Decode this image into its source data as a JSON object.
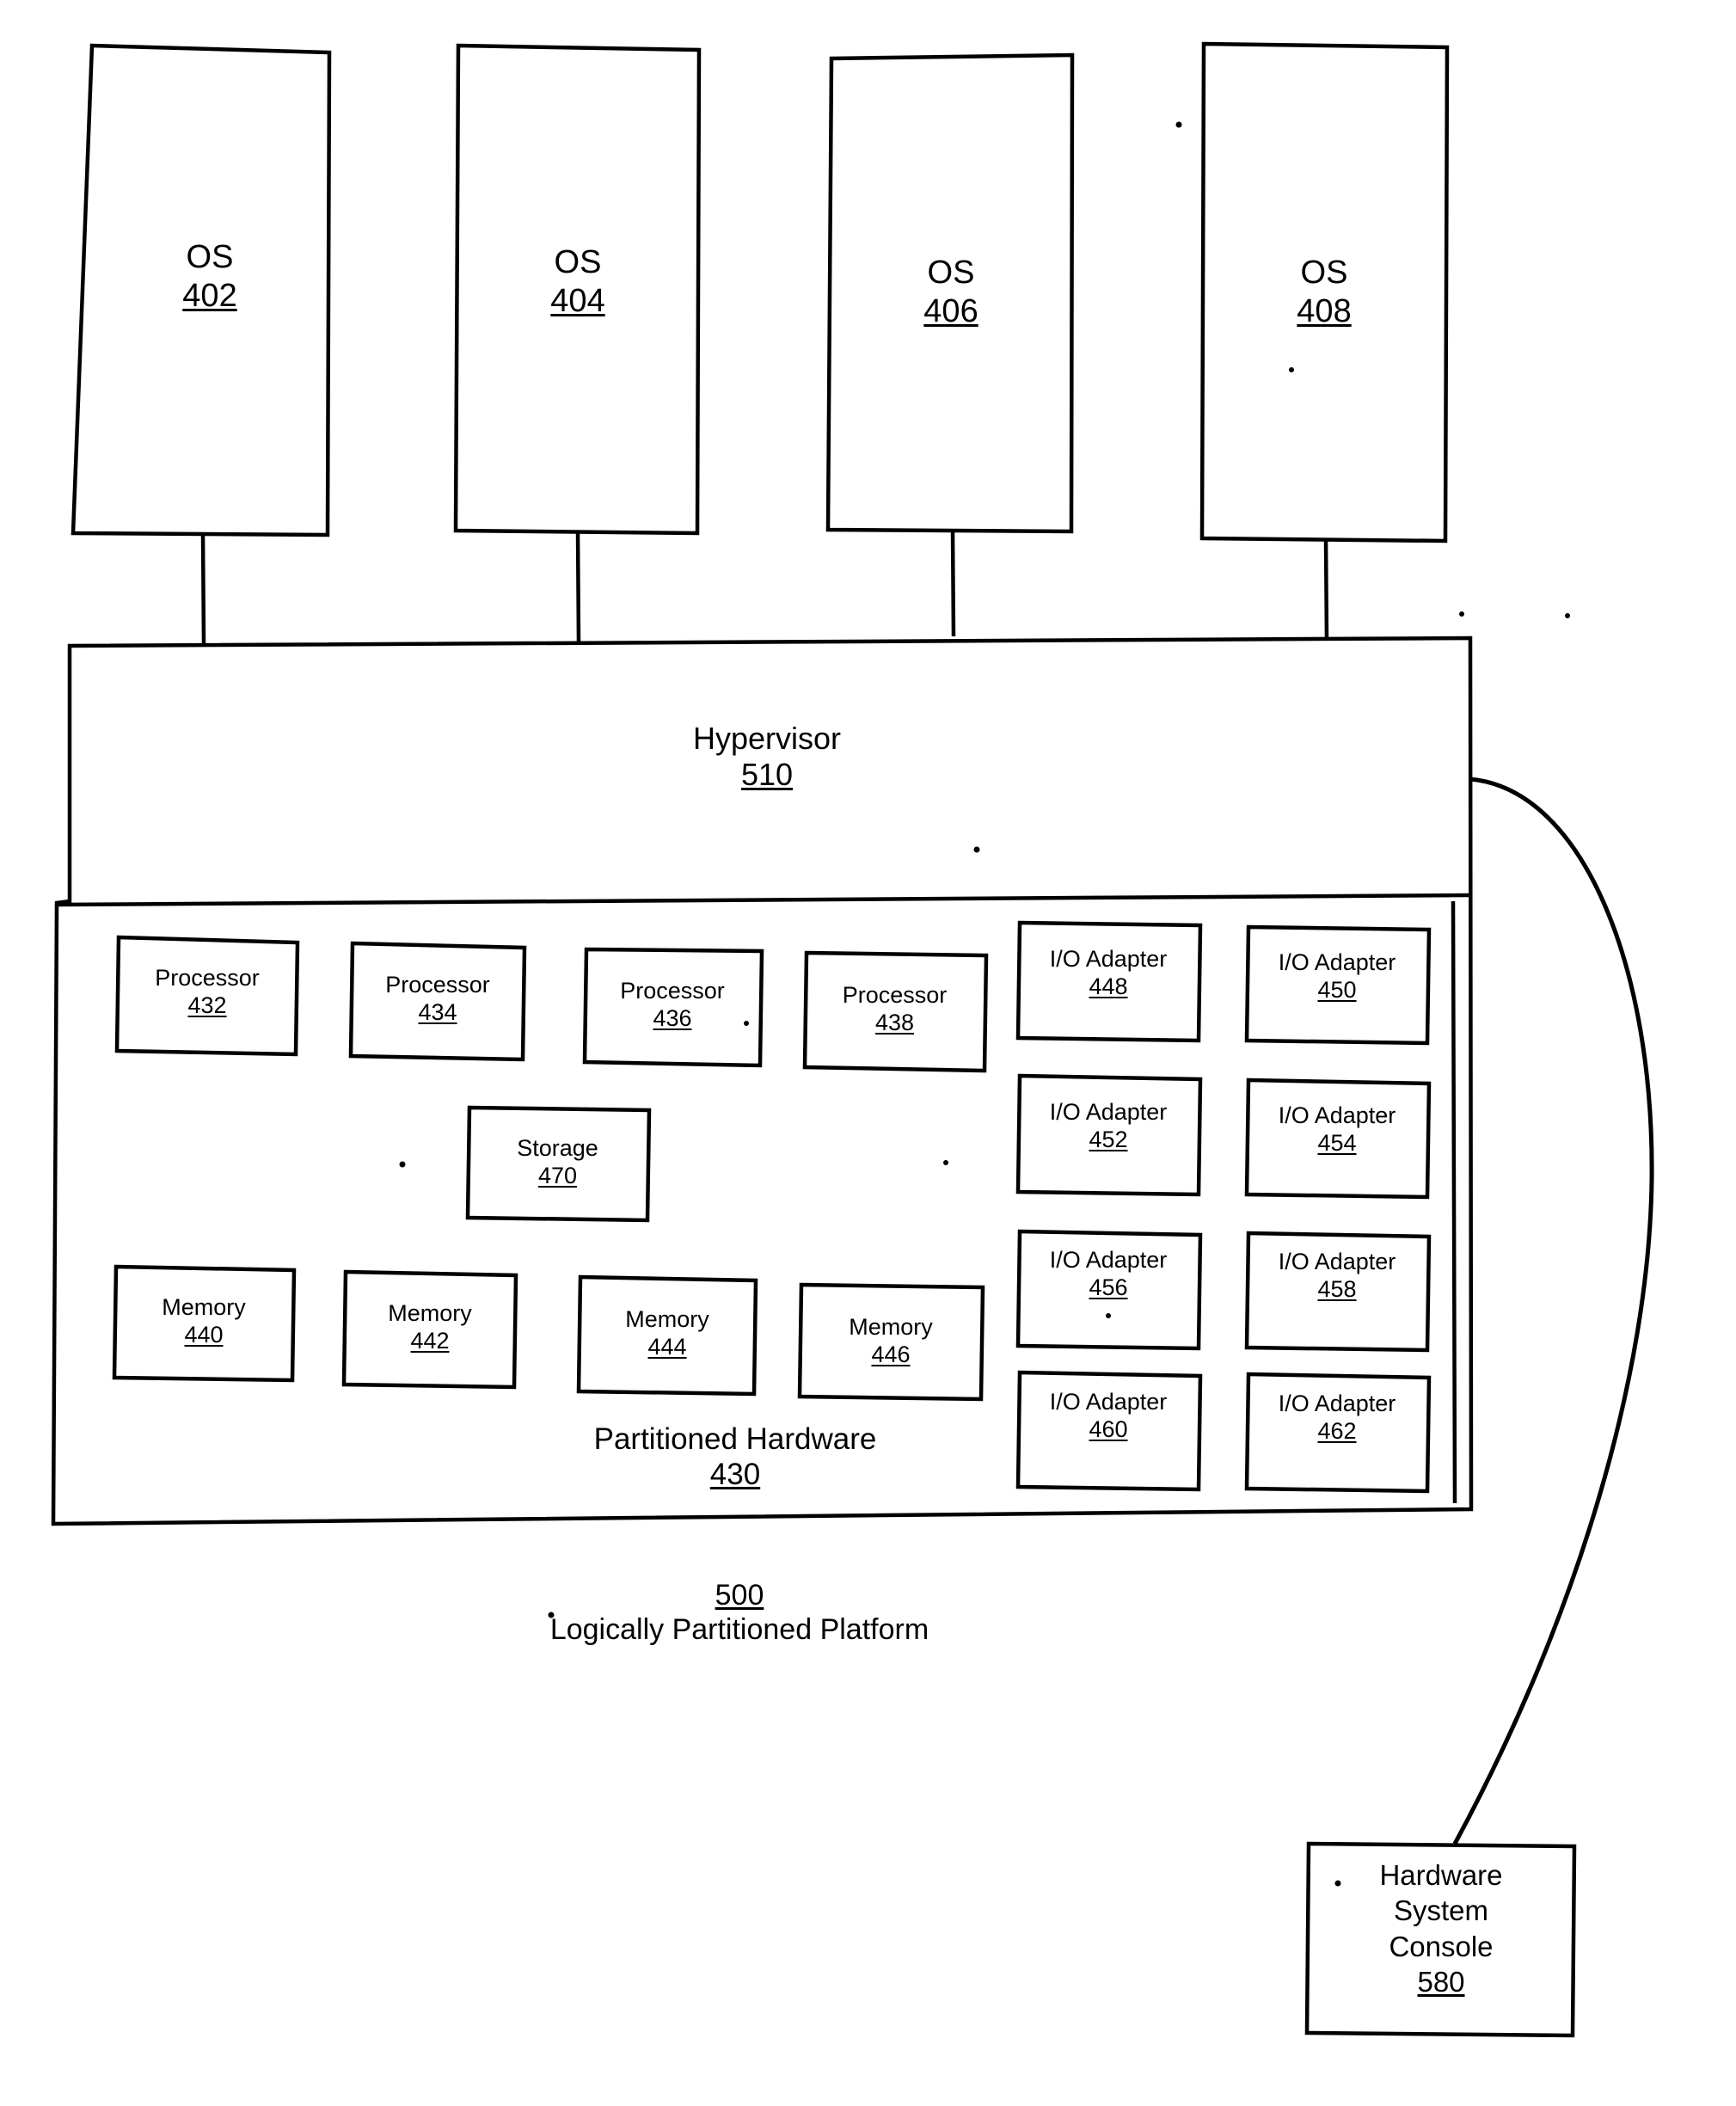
{
  "figure": {
    "caption_ref": "500",
    "caption_text": "Logically Partitioned Platform"
  },
  "os_partitions": [
    {
      "name": "os-402",
      "label": "OS",
      "ref": "402"
    },
    {
      "name": "os-404",
      "label": "OS",
      "ref": "404"
    },
    {
      "name": "os-406",
      "label": "OS",
      "ref": "406"
    },
    {
      "name": "os-408",
      "label": "OS",
      "ref": "408"
    }
  ],
  "hypervisor": {
    "label": "Hypervisor",
    "ref": "510"
  },
  "partitioned_hardware": {
    "label": "Partitioned Hardware",
    "ref": "430",
    "processors": [
      {
        "label": "Processor",
        "ref": "432"
      },
      {
        "label": "Processor",
        "ref": "434"
      },
      {
        "label": "Processor",
        "ref": "436"
      },
      {
        "label": "Processor",
        "ref": "438"
      }
    ],
    "storage": {
      "label": "Storage",
      "ref": "470"
    },
    "memories": [
      {
        "label": "Memory",
        "ref": "440"
      },
      {
        "label": "Memory",
        "ref": "442"
      },
      {
        "label": "Memory",
        "ref": "444"
      },
      {
        "label": "Memory",
        "ref": "446"
      }
    ],
    "io_adapters": [
      {
        "label": "I/O Adapter",
        "ref": "448"
      },
      {
        "label": "I/O Adapter",
        "ref": "450"
      },
      {
        "label": "I/O Adapter",
        "ref": "452"
      },
      {
        "label": "I/O Adapter",
        "ref": "454"
      },
      {
        "label": "I/O Adapter",
        "ref": "456"
      },
      {
        "label": "I/O Adapter",
        "ref": "458"
      },
      {
        "label": "I/O Adapter",
        "ref": "460"
      },
      {
        "label": "I/O Adapter",
        "ref": "462"
      }
    ]
  },
  "hardware_system_console": {
    "line1": "Hardware",
    "line2": "System",
    "line3": "Console",
    "ref": "580"
  },
  "colors": {
    "ink": "#000000",
    "paper": "#ffffff"
  }
}
